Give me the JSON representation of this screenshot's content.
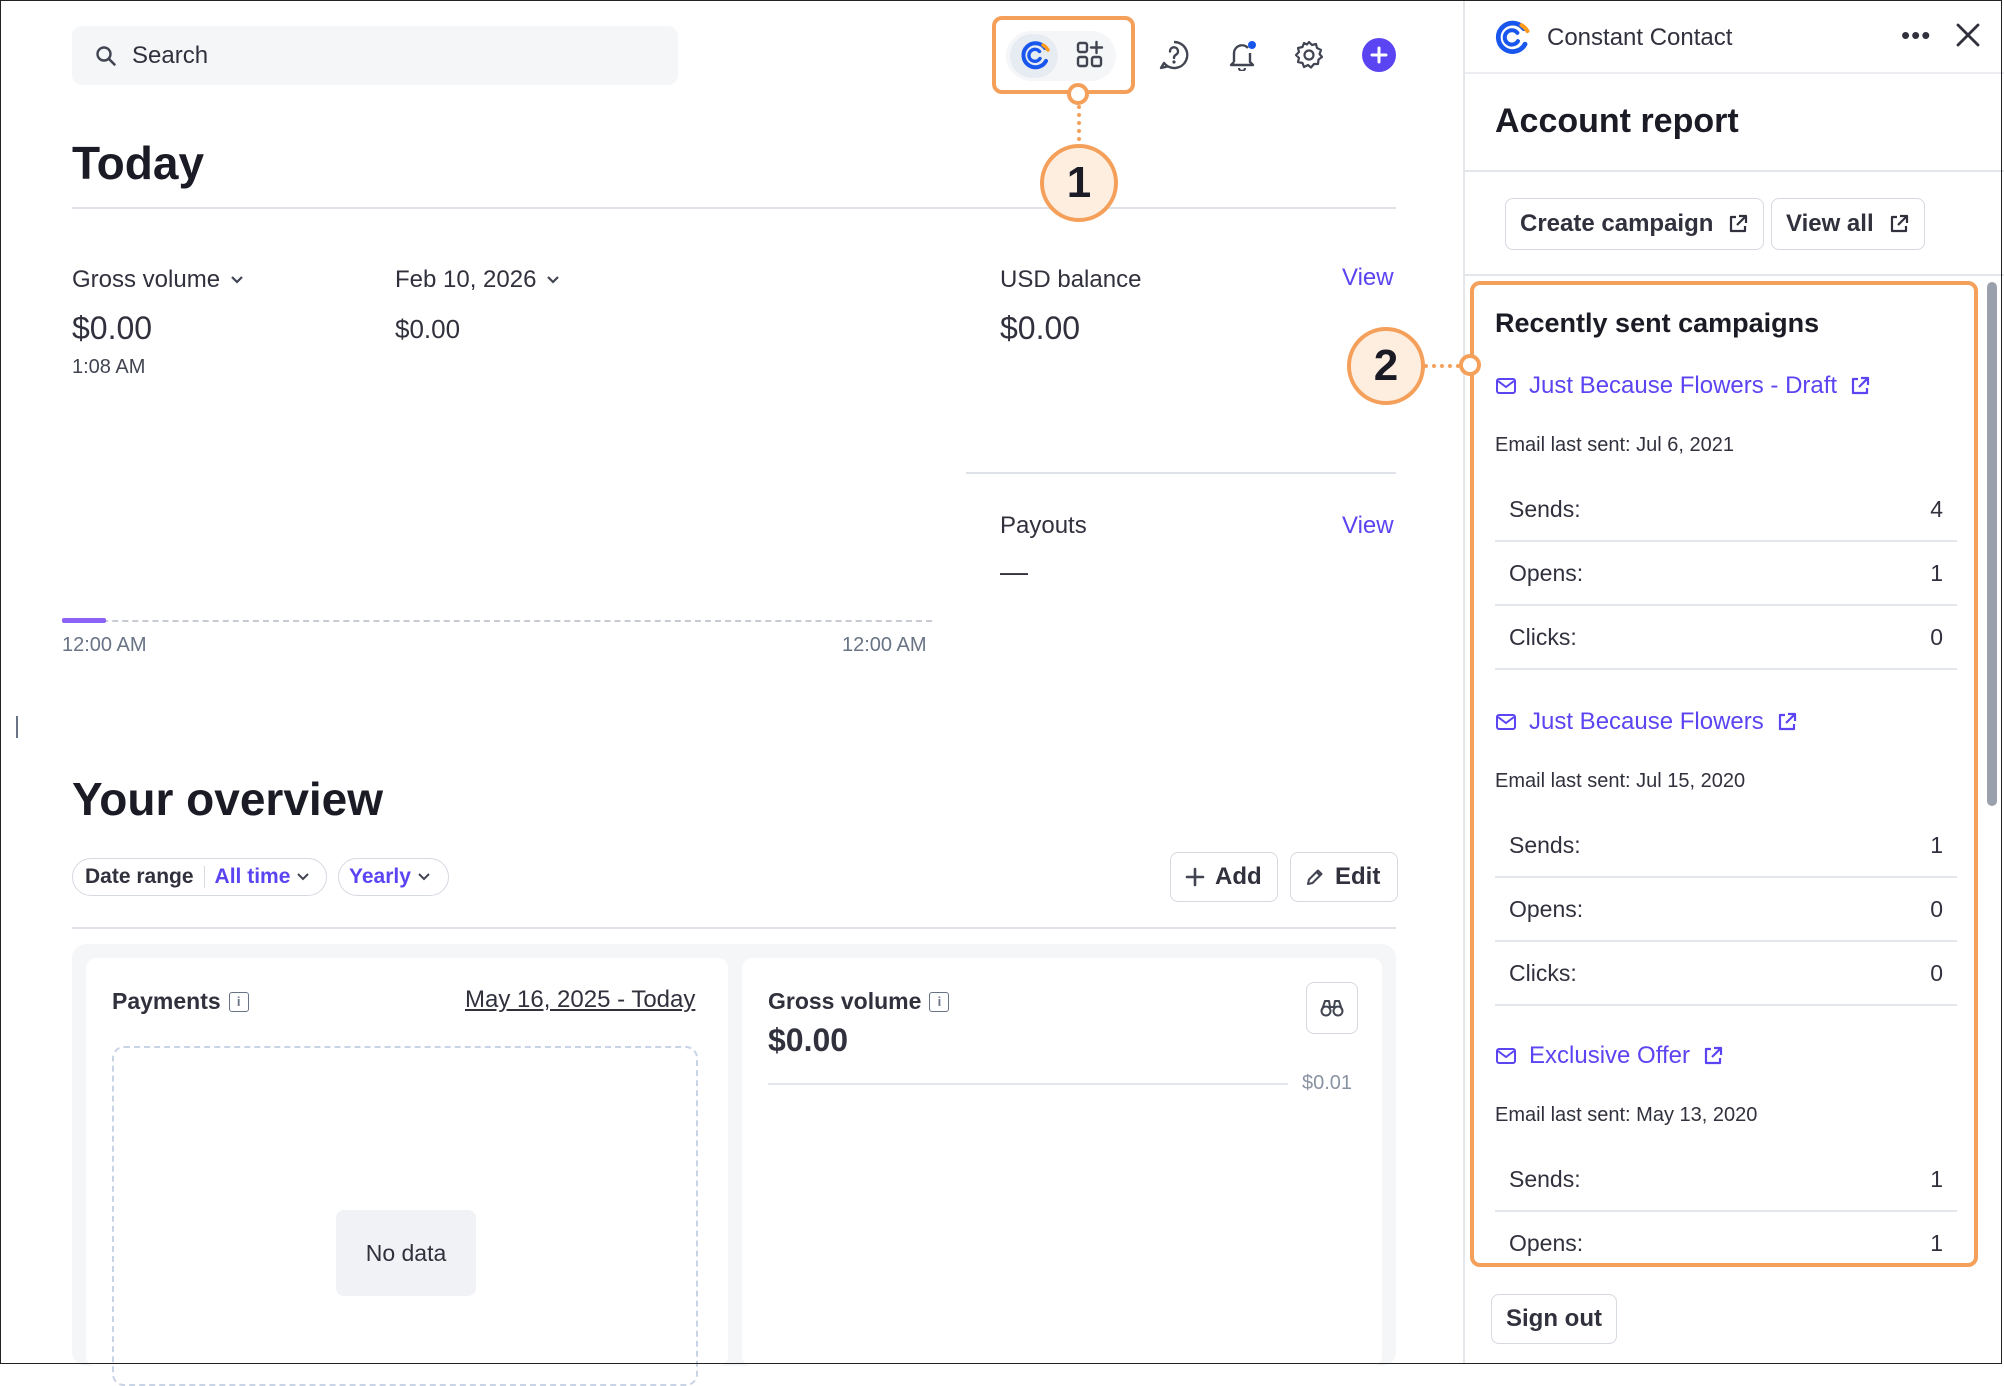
{
  "search": {
    "placeholder": "Search"
  },
  "today": {
    "title": "Today",
    "gross_volume_label": "Gross volume",
    "gross_volume_value": "$0.00",
    "gross_volume_time": "1:08 AM",
    "compare_date_label": "Feb 10, 2026",
    "compare_value": "$0.00",
    "usd_balance_label": "USD balance",
    "usd_balance_value": "$0.00",
    "view_label": "View",
    "payouts_label": "Payouts",
    "payouts_value": "—",
    "payouts_view_label": "View",
    "chart_start_tick": "12:00 AM",
    "chart_end_tick": "12:00 AM"
  },
  "overview": {
    "title": "Your overview",
    "date_range_label": "Date range",
    "date_range_value": "All time",
    "interval_value": "Yearly",
    "add_label": "Add",
    "edit_label": "Edit",
    "payments_card": {
      "title": "Payments",
      "date_range": "May 16, 2025 - Today",
      "empty_text": "No data"
    },
    "gross_card": {
      "title": "Gross volume",
      "value": "$0.00",
      "axis_tick": "$0.01"
    }
  },
  "panel": {
    "app_name": "Constant Contact",
    "title": "Account report",
    "create_campaign_label": "Create campaign",
    "view_all_label": "View all",
    "recent_title": "Recently sent campaigns",
    "campaigns": [
      {
        "name": "Just Because Flowers - Draft",
        "last_sent": "Email last sent: Jul 6, 2021",
        "stats": [
          {
            "k": "Sends:",
            "v": "4"
          },
          {
            "k": "Opens:",
            "v": "1"
          },
          {
            "k": "Clicks:",
            "v": "0"
          }
        ]
      },
      {
        "name": "Just Because Flowers",
        "last_sent": "Email last sent: Jul 15, 2020",
        "stats": [
          {
            "k": "Sends:",
            "v": "1"
          },
          {
            "k": "Opens:",
            "v": "0"
          },
          {
            "k": "Clicks:",
            "v": "0"
          }
        ]
      },
      {
        "name": "Exclusive Offer",
        "last_sent": "Email last sent: May 13, 2020",
        "stats": [
          {
            "k": "Sends:",
            "v": "1"
          },
          {
            "k": "Opens:",
            "v": "1"
          }
        ]
      }
    ],
    "sign_out_label": "Sign out"
  },
  "callouts": {
    "one": "1",
    "two": "2"
  },
  "colors": {
    "accent": "#5b44f2",
    "callout": "#f5a05a",
    "callout_fill": "#fdeee0",
    "ctc_blue": "#1856ed",
    "ctc_orange": "#ff9a1a"
  },
  "icons": [
    "search-icon",
    "constant-contact-logo-icon",
    "apps-grid-icon",
    "help-icon",
    "bell-icon",
    "gear-icon",
    "plus-icon",
    "chevron-down-icon",
    "external-link-icon",
    "mail-icon",
    "more-icon",
    "close-icon",
    "pencil-icon",
    "binoculars-icon",
    "info-icon"
  ]
}
